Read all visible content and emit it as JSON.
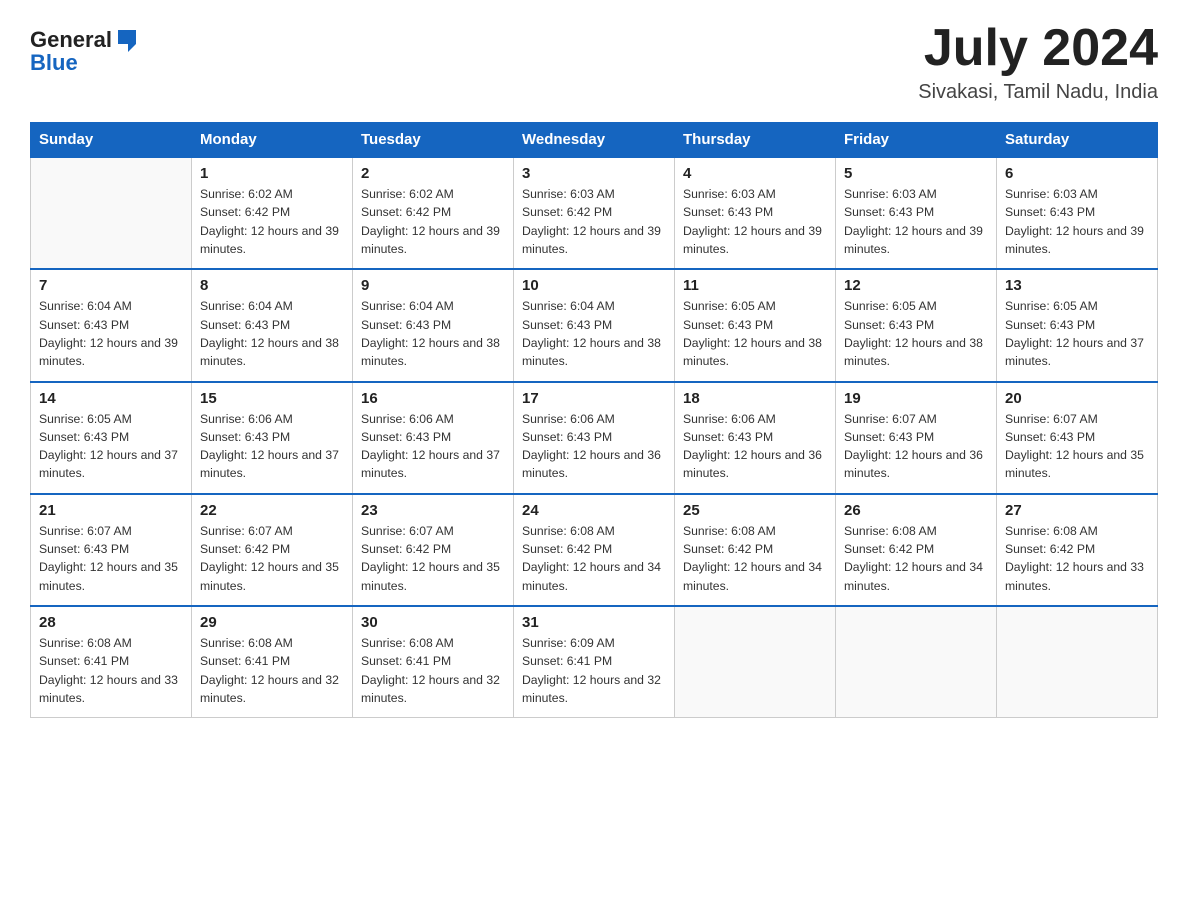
{
  "header": {
    "logo_general": "General",
    "logo_blue": "Blue",
    "title": "July 2024",
    "subtitle": "Sivakasi, Tamil Nadu, India"
  },
  "calendar": {
    "days_of_week": [
      "Sunday",
      "Monday",
      "Tuesday",
      "Wednesday",
      "Thursday",
      "Friday",
      "Saturday"
    ],
    "weeks": [
      [
        {
          "day": "",
          "sunrise": "",
          "sunset": "",
          "daylight": "",
          "empty": true
        },
        {
          "day": "1",
          "sunrise": "Sunrise: 6:02 AM",
          "sunset": "Sunset: 6:42 PM",
          "daylight": "Daylight: 12 hours and 39 minutes."
        },
        {
          "day": "2",
          "sunrise": "Sunrise: 6:02 AM",
          "sunset": "Sunset: 6:42 PM",
          "daylight": "Daylight: 12 hours and 39 minutes."
        },
        {
          "day": "3",
          "sunrise": "Sunrise: 6:03 AM",
          "sunset": "Sunset: 6:42 PM",
          "daylight": "Daylight: 12 hours and 39 minutes."
        },
        {
          "day": "4",
          "sunrise": "Sunrise: 6:03 AM",
          "sunset": "Sunset: 6:43 PM",
          "daylight": "Daylight: 12 hours and 39 minutes."
        },
        {
          "day": "5",
          "sunrise": "Sunrise: 6:03 AM",
          "sunset": "Sunset: 6:43 PM",
          "daylight": "Daylight: 12 hours and 39 minutes."
        },
        {
          "day": "6",
          "sunrise": "Sunrise: 6:03 AM",
          "sunset": "Sunset: 6:43 PM",
          "daylight": "Daylight: 12 hours and 39 minutes."
        }
      ],
      [
        {
          "day": "7",
          "sunrise": "Sunrise: 6:04 AM",
          "sunset": "Sunset: 6:43 PM",
          "daylight": "Daylight: 12 hours and 39 minutes."
        },
        {
          "day": "8",
          "sunrise": "Sunrise: 6:04 AM",
          "sunset": "Sunset: 6:43 PM",
          "daylight": "Daylight: 12 hours and 38 minutes."
        },
        {
          "day": "9",
          "sunrise": "Sunrise: 6:04 AM",
          "sunset": "Sunset: 6:43 PM",
          "daylight": "Daylight: 12 hours and 38 minutes."
        },
        {
          "day": "10",
          "sunrise": "Sunrise: 6:04 AM",
          "sunset": "Sunset: 6:43 PM",
          "daylight": "Daylight: 12 hours and 38 minutes."
        },
        {
          "day": "11",
          "sunrise": "Sunrise: 6:05 AM",
          "sunset": "Sunset: 6:43 PM",
          "daylight": "Daylight: 12 hours and 38 minutes."
        },
        {
          "day": "12",
          "sunrise": "Sunrise: 6:05 AM",
          "sunset": "Sunset: 6:43 PM",
          "daylight": "Daylight: 12 hours and 38 minutes."
        },
        {
          "day": "13",
          "sunrise": "Sunrise: 6:05 AM",
          "sunset": "Sunset: 6:43 PM",
          "daylight": "Daylight: 12 hours and 37 minutes."
        }
      ],
      [
        {
          "day": "14",
          "sunrise": "Sunrise: 6:05 AM",
          "sunset": "Sunset: 6:43 PM",
          "daylight": "Daylight: 12 hours and 37 minutes."
        },
        {
          "day": "15",
          "sunrise": "Sunrise: 6:06 AM",
          "sunset": "Sunset: 6:43 PM",
          "daylight": "Daylight: 12 hours and 37 minutes."
        },
        {
          "day": "16",
          "sunrise": "Sunrise: 6:06 AM",
          "sunset": "Sunset: 6:43 PM",
          "daylight": "Daylight: 12 hours and 37 minutes."
        },
        {
          "day": "17",
          "sunrise": "Sunrise: 6:06 AM",
          "sunset": "Sunset: 6:43 PM",
          "daylight": "Daylight: 12 hours and 36 minutes."
        },
        {
          "day": "18",
          "sunrise": "Sunrise: 6:06 AM",
          "sunset": "Sunset: 6:43 PM",
          "daylight": "Daylight: 12 hours and 36 minutes."
        },
        {
          "day": "19",
          "sunrise": "Sunrise: 6:07 AM",
          "sunset": "Sunset: 6:43 PM",
          "daylight": "Daylight: 12 hours and 36 minutes."
        },
        {
          "day": "20",
          "sunrise": "Sunrise: 6:07 AM",
          "sunset": "Sunset: 6:43 PM",
          "daylight": "Daylight: 12 hours and 35 minutes."
        }
      ],
      [
        {
          "day": "21",
          "sunrise": "Sunrise: 6:07 AM",
          "sunset": "Sunset: 6:43 PM",
          "daylight": "Daylight: 12 hours and 35 minutes."
        },
        {
          "day": "22",
          "sunrise": "Sunrise: 6:07 AM",
          "sunset": "Sunset: 6:42 PM",
          "daylight": "Daylight: 12 hours and 35 minutes."
        },
        {
          "day": "23",
          "sunrise": "Sunrise: 6:07 AM",
          "sunset": "Sunset: 6:42 PM",
          "daylight": "Daylight: 12 hours and 35 minutes."
        },
        {
          "day": "24",
          "sunrise": "Sunrise: 6:08 AM",
          "sunset": "Sunset: 6:42 PM",
          "daylight": "Daylight: 12 hours and 34 minutes."
        },
        {
          "day": "25",
          "sunrise": "Sunrise: 6:08 AM",
          "sunset": "Sunset: 6:42 PM",
          "daylight": "Daylight: 12 hours and 34 minutes."
        },
        {
          "day": "26",
          "sunrise": "Sunrise: 6:08 AM",
          "sunset": "Sunset: 6:42 PM",
          "daylight": "Daylight: 12 hours and 34 minutes."
        },
        {
          "day": "27",
          "sunrise": "Sunrise: 6:08 AM",
          "sunset": "Sunset: 6:42 PM",
          "daylight": "Daylight: 12 hours and 33 minutes."
        }
      ],
      [
        {
          "day": "28",
          "sunrise": "Sunrise: 6:08 AM",
          "sunset": "Sunset: 6:41 PM",
          "daylight": "Daylight: 12 hours and 33 minutes."
        },
        {
          "day": "29",
          "sunrise": "Sunrise: 6:08 AM",
          "sunset": "Sunset: 6:41 PM",
          "daylight": "Daylight: 12 hours and 32 minutes."
        },
        {
          "day": "30",
          "sunrise": "Sunrise: 6:08 AM",
          "sunset": "Sunset: 6:41 PM",
          "daylight": "Daylight: 12 hours and 32 minutes."
        },
        {
          "day": "31",
          "sunrise": "Sunrise: 6:09 AM",
          "sunset": "Sunset: 6:41 PM",
          "daylight": "Daylight: 12 hours and 32 minutes."
        },
        {
          "day": "",
          "sunrise": "",
          "sunset": "",
          "daylight": "",
          "empty": true
        },
        {
          "day": "",
          "sunrise": "",
          "sunset": "",
          "daylight": "",
          "empty": true
        },
        {
          "day": "",
          "sunrise": "",
          "sunset": "",
          "daylight": "",
          "empty": true
        }
      ]
    ]
  }
}
